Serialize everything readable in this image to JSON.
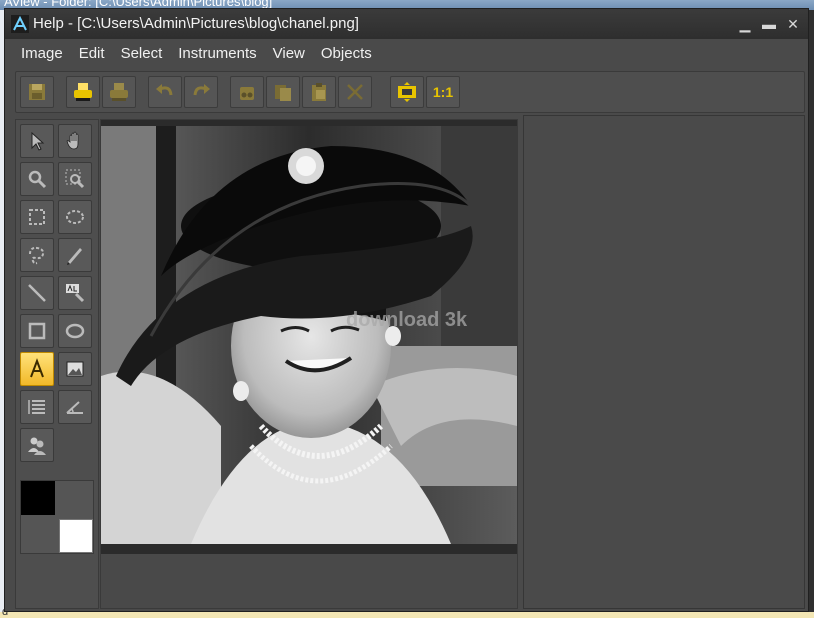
{
  "background_window": {
    "title": "AView - Folder: [C:\\Users\\Admin\\Pictures\\blog]",
    "footer_text": "d"
  },
  "window": {
    "title": "Help - [C:\\Users\\Admin\\Pictures\\blog\\chanel.png]",
    "controls": [
      "minimize",
      "maximize",
      "close"
    ]
  },
  "menu": [
    "Image",
    "Edit",
    "Select",
    "Instruments",
    "View",
    "Objects"
  ],
  "toolbar": {
    "buttons": [
      {
        "name": "save-icon"
      },
      {
        "name": "print-icon"
      },
      {
        "name": "print-preview-icon"
      },
      {
        "name": "undo-icon"
      },
      {
        "name": "redo-icon"
      },
      {
        "name": "cut-icon"
      },
      {
        "name": "copy-icon"
      },
      {
        "name": "paste-icon"
      },
      {
        "name": "delete-icon"
      },
      {
        "name": "fit-window-icon"
      }
    ],
    "actual_size_label": "1:1"
  },
  "tools": [
    "pointer-icon",
    "hand-icon",
    "zoom-icon",
    "zoom-region-icon",
    "rect-select-icon",
    "ellipse-select-icon",
    "lasso-icon",
    "pencil-icon",
    "line-icon",
    "text-replace-icon",
    "rectangle-icon",
    "ellipse-icon",
    "text-tool-icon",
    "image-icon",
    "list-icon",
    "angle-icon",
    "users-icon"
  ],
  "active_tool": "text-tool-icon",
  "colors": {
    "foreground": "#000000",
    "background": "#ffffff",
    "accent": "#e8c400"
  },
  "image": {
    "watermark": "download 3k"
  }
}
